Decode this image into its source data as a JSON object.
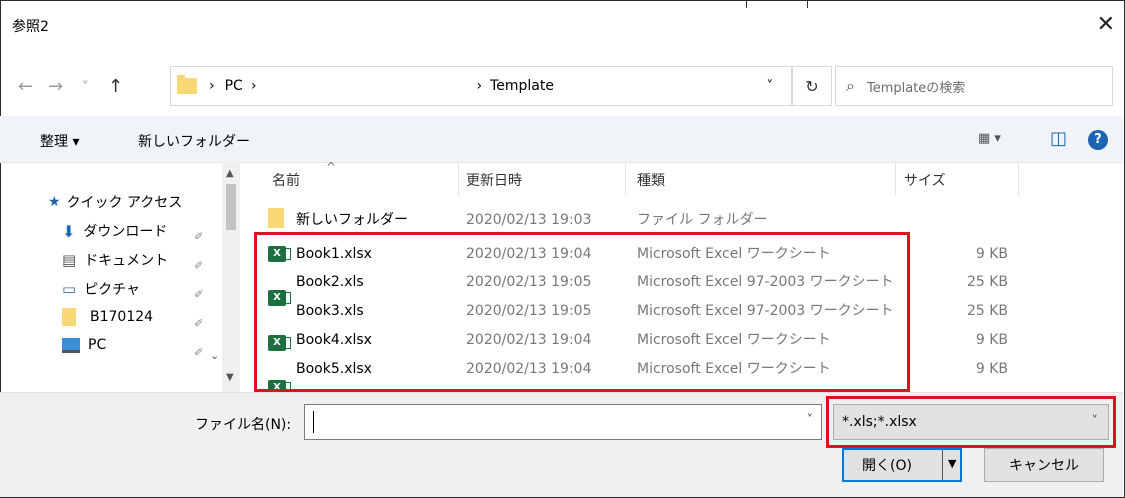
{
  "window": {
    "title": "参照2",
    "close": "✕"
  },
  "nav": {
    "back": "←",
    "forward": "→",
    "recent": "˅",
    "up": "↑"
  },
  "breadcrumb": {
    "sep1": "›",
    "pc": "PC",
    "sep2": "›",
    "sep3": "›",
    "current": "Template",
    "dropdown": "˅"
  },
  "refresh": "↻",
  "search": {
    "icon": "⌕",
    "placeholder": "Templateの検索"
  },
  "toolbar": {
    "organize": "整理 ▾",
    "new_folder": "新しいフォルダー",
    "view": "▦ ▾",
    "pane": "◫",
    "help": "?"
  },
  "sidebar": {
    "items": [
      {
        "label": "クイック アクセス",
        "icon": "★"
      },
      {
        "label": "ダウンロード",
        "icon": "⬇",
        "pin": "📌"
      },
      {
        "label": "ドキュメント",
        "icon": "▤",
        "pin": "📌"
      },
      {
        "label": "ピクチャ",
        "icon": "▭",
        "pin": "📌"
      },
      {
        "label": "B170124",
        "icon": "folder",
        "pin": "📌"
      },
      {
        "label": "PC",
        "icon": "pc",
        "pin": "📌"
      }
    ]
  },
  "columns": {
    "name": "名前",
    "modified": "更新日時",
    "type": "種類",
    "size": "サイズ",
    "sort": "^"
  },
  "files": [
    {
      "name": "新しいフォルダー",
      "date": "2020/02/13 19:03",
      "type": "ファイル フォルダー",
      "size": "",
      "kind": "folder"
    },
    {
      "name": "Book1.xlsx",
      "date": "2020/02/13 19:04",
      "type": "Microsoft Excel ワークシート",
      "size": "9 KB",
      "kind": "x"
    },
    {
      "name": "Book2.xls",
      "date": "2020/02/13 19:05",
      "type": "Microsoft Excel 97-2003 ワークシート",
      "size": "25 KB",
      "kind": "x"
    },
    {
      "name": "Book3.xls",
      "date": "2020/02/13 19:05",
      "type": "Microsoft Excel 97-2003 ワークシート",
      "size": "25 KB",
      "kind": "x"
    },
    {
      "name": "Book4.xlsx",
      "date": "2020/02/13 19:04",
      "type": "Microsoft Excel ワークシート",
      "size": "9 KB",
      "kind": "x"
    },
    {
      "name": "Book5.xlsx",
      "date": "2020/02/13 19:04",
      "type": "Microsoft Excel ワークシート",
      "size": "9 KB",
      "kind": "x"
    }
  ],
  "bottom": {
    "filename_label": "ファイル名(N):",
    "filename_value": "",
    "filter_value": "*.xls;*.xlsx",
    "open_label": "開く(O)",
    "cancel_label": "キャンセル",
    "dropdown": "˅"
  },
  "colors": {
    "highlight": "#e0101f",
    "excel": "#1d6f42",
    "folder": "#f8d775"
  }
}
